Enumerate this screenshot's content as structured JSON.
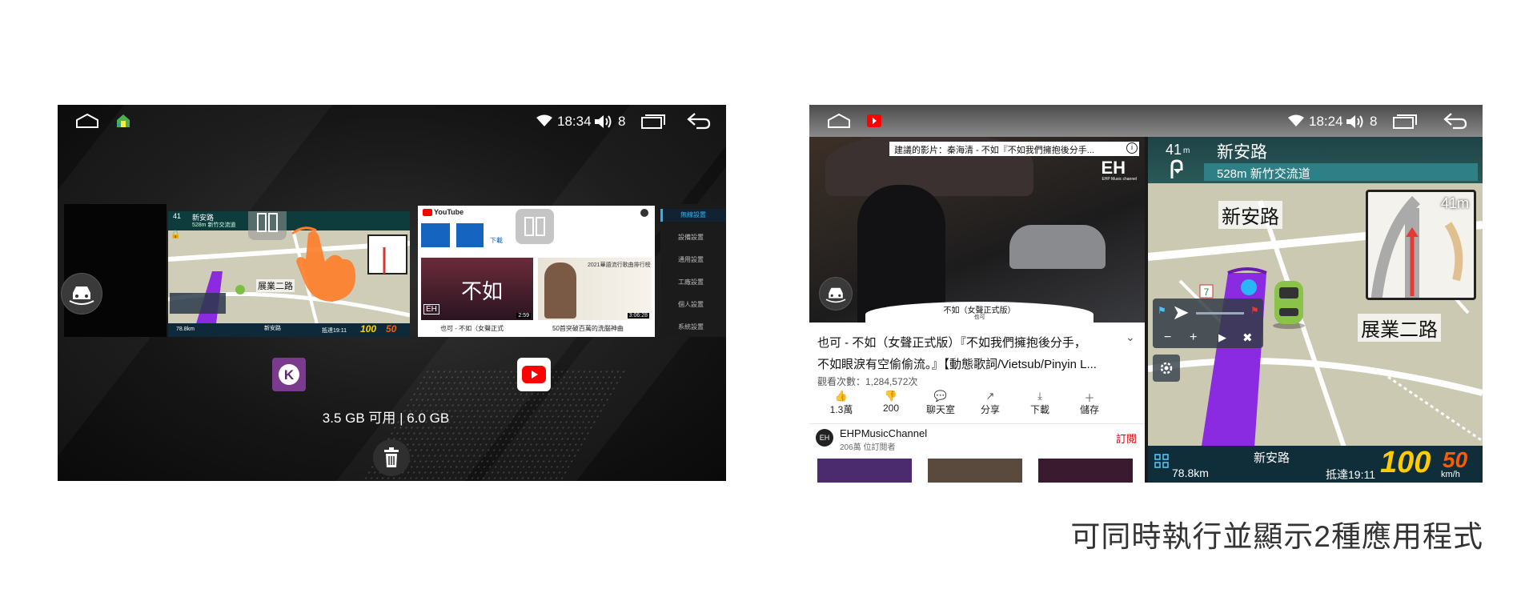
{
  "left_screen": {
    "status": {
      "time": "18:34",
      "volume": "8"
    },
    "mini_nav": {
      "street": "新安路",
      "next": "528m 新竹交流道",
      "dist": "41",
      "place": "展業二路",
      "bottom_street": "新安路",
      "eta": "抵達19:11",
      "km": "78.8km",
      "speed": "100",
      "limit": "50"
    },
    "mini_yt": {
      "brand": "YouTube",
      "tile1_label": "下載",
      "video1_title": "也可 - 不如（女聲正式",
      "video1_time": "2:59",
      "video2_title": "50首突破百萬的洗腦神曲",
      "video2_time": "3:06:28",
      "video1_text": "不如",
      "video2_text": "2021華語流行歌曲排行榜"
    },
    "settings_items": [
      "無線設置",
      "設備設置",
      "通用設置",
      "工廠設置",
      "個人設置",
      "系統設置"
    ],
    "memory_text": "3.5 GB 可用 | 6.0 GB"
  },
  "right_screen": {
    "status": {
      "time": "18:24",
      "volume": "8"
    },
    "video": {
      "suggestion": "建議的影片：秦海清 - 不如『不如我們擁抱後分手...",
      "lyric_title": "不如（女聲正式版）",
      "lyric_sub": "也可",
      "logo": "EH",
      "logo_sub": "EHP Music channel"
    },
    "title_line1": "也可 - 不如（女聲正式版）『不如我們擁抱後分手，",
    "title_line2": "不如眼淚有空偷偷流。』【動態歌詞/Vietsub/Pinyin L...",
    "views": "觀看次數：1,284,572次",
    "actions": [
      {
        "icon": "thumbs-up-icon",
        "glyph": "👍",
        "label": "1.3萬"
      },
      {
        "icon": "thumbs-down-icon",
        "glyph": "👎",
        "label": "200"
      },
      {
        "icon": "chat-icon",
        "glyph": "💬",
        "label": "聊天室"
      },
      {
        "icon": "share-icon",
        "glyph": "↗",
        "label": "分享"
      },
      {
        "icon": "download-icon",
        "glyph": "⤓",
        "label": "下載"
      },
      {
        "icon": "save-icon",
        "glyph": "＋",
        "label": "儲存"
      }
    ],
    "channel": {
      "name": "EHPMusicChannel",
      "subs": "206萬 位訂閱者",
      "subscribe": "訂閱",
      "avatar": "EH"
    },
    "nav": {
      "top_dist": "41",
      "top_unit": "m",
      "street": "新安路",
      "next_turn": "528m 新竹交流道",
      "label_a": "新安路",
      "label_b": "展業二路",
      "inset_dist": "41m",
      "bottom_street": "新安路",
      "km": "78.8km",
      "eta": "抵達19:11",
      "speed": "100",
      "limit": "50",
      "unit": "km/h"
    }
  },
  "caption": "可同時執行並顯示2種應用程式"
}
